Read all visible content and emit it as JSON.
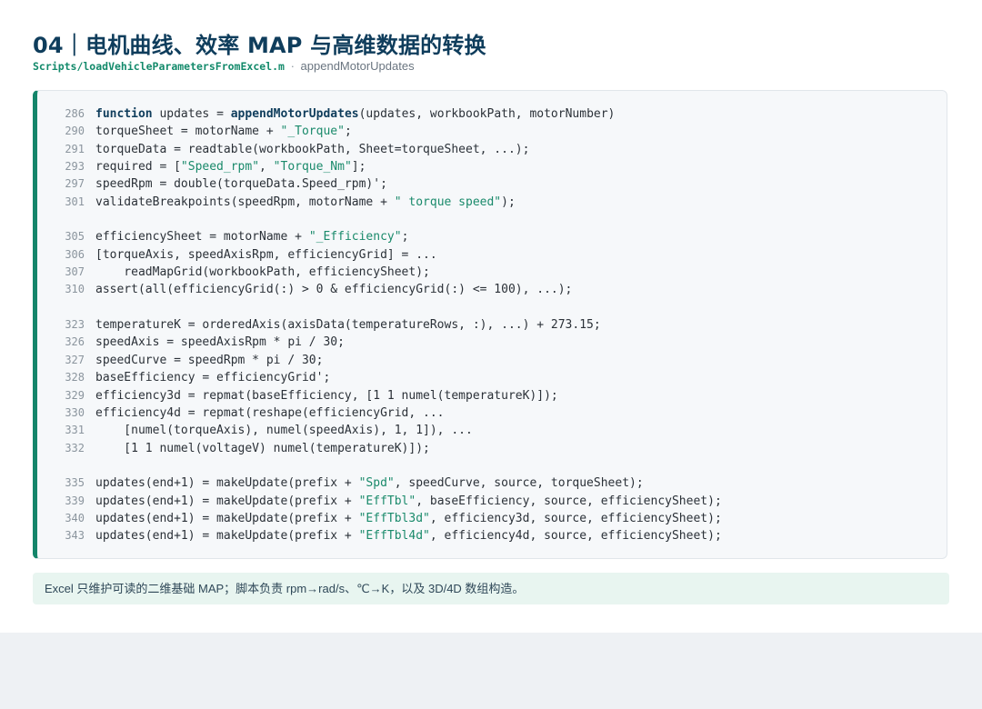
{
  "page": {
    "title": "04｜电机曲线、效率 MAP 与高维数据的转换",
    "subtitle_path": "Scripts/loadVehicleParametersFromExcel.m",
    "subtitle_sep": "·",
    "subtitle_func": "appendMotorUpdates"
  },
  "code_blocks": [
    [
      {
        "num": "286",
        "parts": [
          {
            "t": "function",
            "c": "kw"
          },
          {
            "t": " updates = "
          },
          {
            "t": "appendMotorUpdates",
            "c": "fn"
          },
          {
            "t": "(updates, workbookPath, motorNumber)"
          }
        ]
      },
      {
        "num": "290",
        "parts": [
          {
            "t": "torqueSheet = motorName + "
          },
          {
            "t": "\"_Torque\"",
            "c": "str"
          },
          {
            "t": ";"
          }
        ]
      },
      {
        "num": "291",
        "parts": [
          {
            "t": "torqueData = readtable(workbookPath, Sheet=torqueSheet, ...);"
          }
        ]
      },
      {
        "num": "293",
        "parts": [
          {
            "t": "required = ["
          },
          {
            "t": "\"Speed_rpm\"",
            "c": "str"
          },
          {
            "t": ", "
          },
          {
            "t": "\"Torque_Nm\"",
            "c": "str"
          },
          {
            "t": "];"
          }
        ]
      },
      {
        "num": "297",
        "parts": [
          {
            "t": "speedRpm = double(torqueData.Speed_rpm)';"
          }
        ]
      },
      {
        "num": "301",
        "parts": [
          {
            "t": "validateBreakpoints(speedRpm, motorName + "
          },
          {
            "t": "\" torque speed\"",
            "c": "str"
          },
          {
            "t": ");"
          }
        ]
      }
    ],
    [
      {
        "num": "305",
        "parts": [
          {
            "t": "efficiencySheet = motorName + "
          },
          {
            "t": "\"_Efficiency\"",
            "c": "str"
          },
          {
            "t": ";"
          }
        ]
      },
      {
        "num": "306",
        "parts": [
          {
            "t": "[torqueAxis, speedAxisRpm, efficiencyGrid] = ..."
          }
        ]
      },
      {
        "num": "307",
        "parts": [
          {
            "t": "    readMapGrid(workbookPath, efficiencySheet);"
          }
        ]
      },
      {
        "num": "310",
        "parts": [
          {
            "t": "assert(all(efficiencyGrid(:) > 0 & efficiencyGrid(:) <= 100), ...);"
          }
        ]
      }
    ],
    [
      {
        "num": "323",
        "parts": [
          {
            "t": "temperatureK = orderedAxis(axisData(temperatureRows, :), ...) + 273.15;"
          }
        ]
      },
      {
        "num": "326",
        "parts": [
          {
            "t": "speedAxis = speedAxisRpm * pi / 30;"
          }
        ]
      },
      {
        "num": "327",
        "parts": [
          {
            "t": "speedCurve = speedRpm * pi / 30;"
          }
        ]
      },
      {
        "num": "328",
        "parts": [
          {
            "t": "baseEfficiency = efficiencyGrid';"
          }
        ]
      },
      {
        "num": "329",
        "parts": [
          {
            "t": "efficiency3d = repmat(baseEfficiency, [1 1 numel(temperatureK)]);"
          }
        ]
      },
      {
        "num": "330",
        "parts": [
          {
            "t": "efficiency4d = repmat(reshape(efficiencyGrid, ..."
          }
        ]
      },
      {
        "num": "331",
        "parts": [
          {
            "t": "    [numel(torqueAxis), numel(speedAxis), 1, 1]), ..."
          }
        ]
      },
      {
        "num": "332",
        "parts": [
          {
            "t": "    [1 1 numel(voltageV) numel(temperatureK)]);"
          }
        ]
      }
    ],
    [
      {
        "num": "335",
        "parts": [
          {
            "t": "updates(end+1) = makeUpdate(prefix + "
          },
          {
            "t": "\"Spd\"",
            "c": "str"
          },
          {
            "t": ", speedCurve, source, torqueSheet);"
          }
        ]
      },
      {
        "num": "339",
        "parts": [
          {
            "t": "updates(end+1) = makeUpdate(prefix + "
          },
          {
            "t": "\"EffTbl\"",
            "c": "str"
          },
          {
            "t": ", baseEfficiency, source, efficiencySheet);"
          }
        ]
      },
      {
        "num": "340",
        "parts": [
          {
            "t": "updates(end+1) = makeUpdate(prefix + "
          },
          {
            "t": "\"EffTbl3d\"",
            "c": "str"
          },
          {
            "t": ", efficiency3d, source, efficiencySheet);"
          }
        ]
      },
      {
        "num": "343",
        "parts": [
          {
            "t": "updates(end+1) = makeUpdate(prefix + "
          },
          {
            "t": "\"EffTbl4d\"",
            "c": "str"
          },
          {
            "t": ", efficiency4d, source, efficiencySheet);"
          }
        ]
      }
    ]
  ],
  "note": {
    "text": "Excel 只维护可读的二维基础 MAP；脚本负责 rpm→rad/s、℃→K，以及 3D/4D 数组构造。"
  },
  "colors": {
    "accent": "#14856a",
    "title": "#0f3d5c",
    "string": "#1a8a6b",
    "note_bg": "#e8f5f0"
  }
}
